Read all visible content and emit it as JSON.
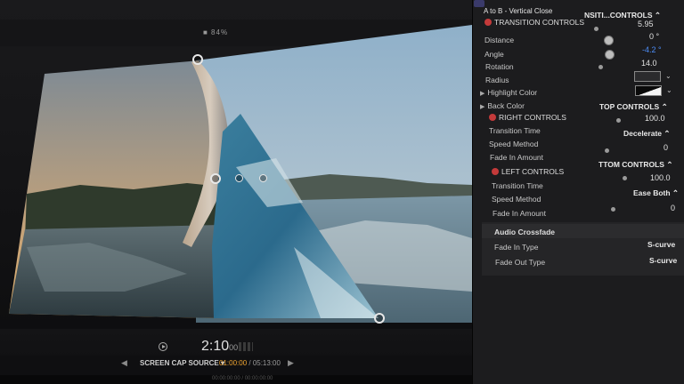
{
  "viewer": {
    "zoom_label": "■ 84%",
    "timecode": "2:10",
    "timecode_frames": "00",
    "source_label": "SCREEN CAP SOURCE ▾",
    "source_time_current": "01:00:00",
    "source_time_sep": " / ",
    "source_time_total": "05:13:00",
    "nav_left": "◀",
    "nav_right": "▶",
    "timeline_text": "00:00:00:00 / 00:00:00:00"
  },
  "inspector": {
    "title": "A to B - Vertical Close",
    "transition_controls": {
      "label": "TRANSITION CONTROLS",
      "dropdown": "NSITI...CONTROLS ⌃",
      "distance_label": "Distance",
      "distance_value": "5.95",
      "angle_label": "Angle",
      "angle_value": "0 °",
      "rotation_label": "Rotation",
      "rotation_value": "-4.2 °",
      "radius_label": "Radius",
      "radius_value": "14.0",
      "highlight_label": "Highlight Color",
      "back_label": "Back Color"
    },
    "right_controls": {
      "label": "RIGHT CONTROLS",
      "dropdown": "TOP CONTROLS ⌃",
      "transition_time_label": "Transition Time",
      "transition_time_value": "100.0",
      "speed_label": "Speed Method",
      "speed_value": "Decelerate ⌃",
      "fade_label": "Fade In Amount",
      "fade_value": "0"
    },
    "left_controls": {
      "label": "LEFT CONTROLS",
      "dropdown": "TTOM CONTROLS ⌃",
      "transition_time_label": "Transition Time",
      "transition_time_value": "100.0",
      "speed_label": "Speed Method",
      "speed_value": "Ease Both ⌃",
      "fade_label": "Fade In Amount",
      "fade_value": "0"
    },
    "audio_crossfade": {
      "label": "Audio Crossfade",
      "fade_in_label": "Fade In Type",
      "fade_in_value": "S-curve",
      "fade_out_label": "Fade Out Type",
      "fade_out_value": "S-curve"
    }
  },
  "colors": {
    "accent_blue": "#4d8df7",
    "reset_red": "#c43a3a",
    "timecode_orange": "#f0a531"
  }
}
